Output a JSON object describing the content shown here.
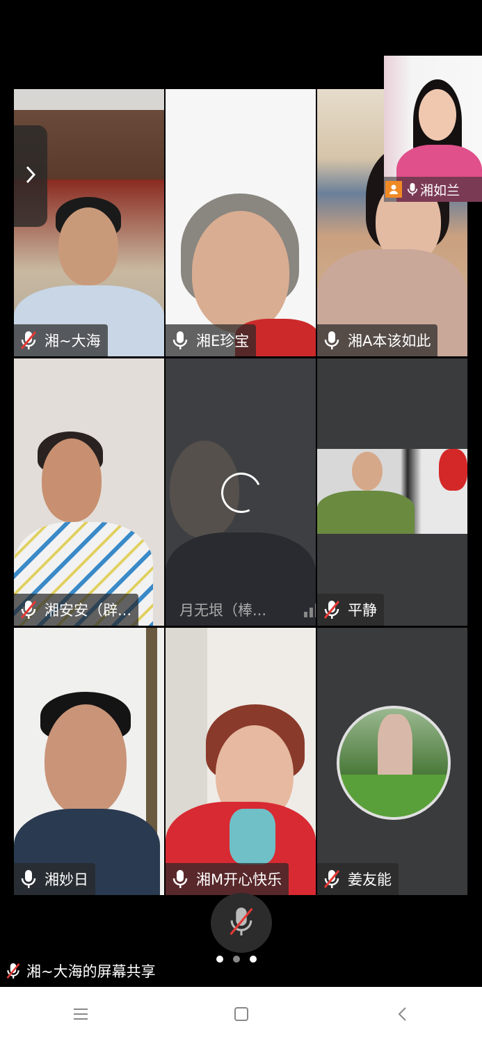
{
  "participants": [
    {
      "name": "湘~大海",
      "mic": "muted"
    },
    {
      "name": "湘E珍宝",
      "mic": "on"
    },
    {
      "name": "湘A本该如此",
      "mic": "on"
    },
    {
      "name": "湘安安（辟...",
      "mic": "muted"
    },
    {
      "name": "月无垠（棒...",
      "mic": "none"
    },
    {
      "name": "平静",
      "mic": "muted"
    },
    {
      "name": "湘妙日",
      "mic": "on"
    },
    {
      "name": "湘M开心快乐",
      "mic": "on"
    },
    {
      "name": "姜友能",
      "mic": "muted"
    }
  ],
  "pip": {
    "name": "湘如兰"
  },
  "share_text": "湘~大海的屏幕共享",
  "page_indicator": {
    "total": 3,
    "active": 2
  },
  "colors": {
    "tile_dark": "#3a3b3d",
    "label_bg": "#2a2a2a",
    "mute_red": "#e53935",
    "pip_badge": "#f08a24"
  }
}
